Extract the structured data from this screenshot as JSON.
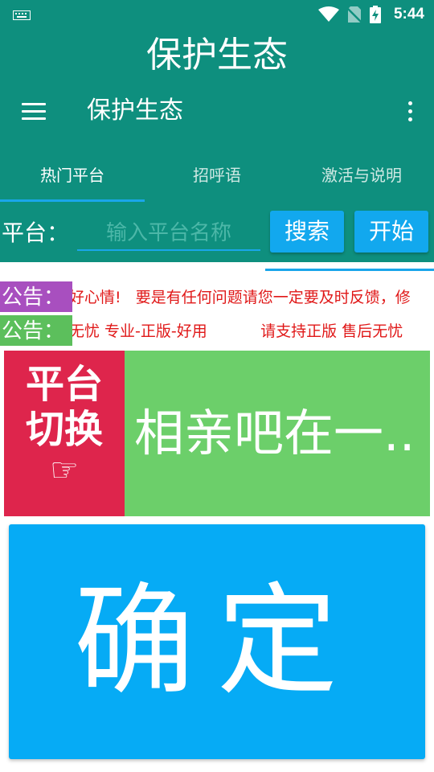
{
  "status_bar": {
    "time": "5:44",
    "icons": [
      "keyboard-icon",
      "wifi-icon",
      "no-sim-icon",
      "battery-charging-icon"
    ]
  },
  "header": {
    "big_title": "保护生态",
    "toolbar_title": "保护生态"
  },
  "tabs": [
    {
      "label": "热门平台",
      "active": true
    },
    {
      "label": "招呼语",
      "active": false
    },
    {
      "label": "激活与说明",
      "active": false
    }
  ],
  "search": {
    "label": "平台：",
    "placeholder": "输入平台名称",
    "search_button": "搜索",
    "start_button": "开始"
  },
  "notices": [
    {
      "label": "公告：",
      "text": "好心情!   要是有任何问题请您一定要及时反馈，修"
    },
    {
      "label": "公告：",
      "text": "无忧 专业-正版-好用           请支持正版 售后无忧"
    }
  ],
  "switch": {
    "line1": "平台",
    "line2": "切换",
    "hand_icon": "☞",
    "current_platform": "相亲吧在一.."
  },
  "confirm_button": "确定",
  "colors": {
    "primary": "#0E8F7E",
    "accent_blue": "#12a8ee",
    "notice_purple": "#a84fbf",
    "notice_green": "#5cbf5c",
    "notice_text_red": "#e01818",
    "switch_red": "#de254c",
    "switch_green": "#6ccf6a",
    "confirm_blue": "#06abf5"
  }
}
